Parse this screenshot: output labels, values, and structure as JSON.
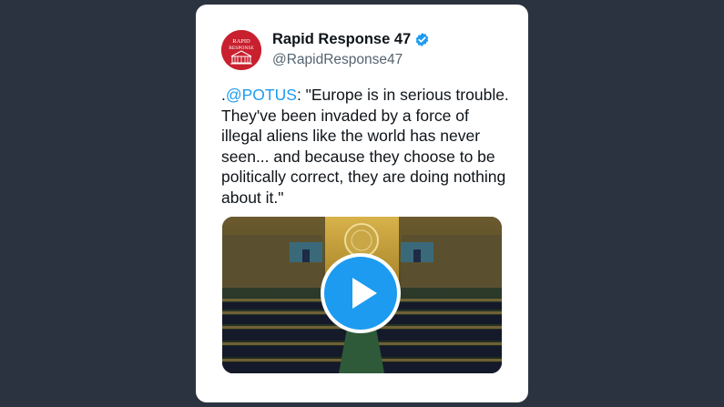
{
  "tweet": {
    "author_name": "Rapid Response 47",
    "handle": "@RapidResponse47",
    "text_prefix": ".",
    "mention": "@POTUS",
    "text_rest": ": \"Europe is in serious trouble. They've been invaded by a force of illegal aliens like the world has never seen... and because they choose to be politically correct, they are doing nothing about it.\"",
    "avatar_text_line1": "RAPID",
    "avatar_text_line2": "RESPONSE"
  },
  "icons": {
    "verified": "verified-badge-icon",
    "play": "play-icon"
  },
  "colors": {
    "background": "#2b3340",
    "card": "#ffffff",
    "accent": "#1d9bf0",
    "avatar": "#c8202e",
    "text": "#0f1419",
    "secondary_text": "#536471"
  }
}
